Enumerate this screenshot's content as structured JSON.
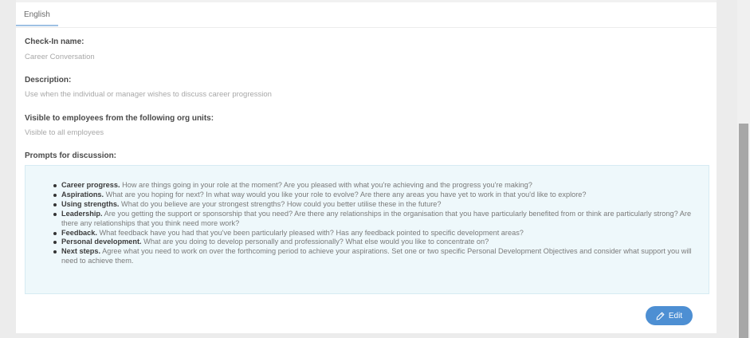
{
  "tabs": [
    {
      "label": "English"
    }
  ],
  "fields": {
    "checkin_name": {
      "label": "Check-In name:",
      "value": "Career Conversation"
    },
    "description": {
      "label": "Description:",
      "value": "Use when the individual or manager wishes to discuss career progression"
    },
    "visibility": {
      "label": "Visible to employees from the following org units:",
      "value": "Visible to all employees"
    },
    "prompts_label": "Prompts for discussion:"
  },
  "prompts": [
    {
      "title": "Career progress.",
      "text": " How are things going in your role at the moment? Are you pleased with what you're achieving and the progress you're making?"
    },
    {
      "title": "Aspirations.",
      "text": " What are you hoping for next? In what way would you like your role to evolve? Are there any areas you have yet to work in that you'd like to explore?"
    },
    {
      "title": "Using strengths.",
      "text": " What do you believe are your strongest strengths? How could you better utilise these in the future?"
    },
    {
      "title": "Leadership.",
      "text": " Are you getting the support or sponsorship that you need? Are there any relationships in the organisation that you have particularly benefited from or think are particularly strong? Are there any relationships that you think need more work?"
    },
    {
      "title": "Feedback.",
      "text": " What feedback have you had that you've been particularly pleased with? Has any feedback pointed to specific development areas?"
    },
    {
      "title": "Personal development.",
      "text": " What are you doing to develop personally and professionally? What else would you like to concentrate on?"
    },
    {
      "title": "Next steps.",
      "text": " Agree what you need to work on over the forthcoming period to achieve your aspirations. Set one or two specific Personal Development Objectives and consider what support you will need to achieve them."
    }
  ],
  "edit_button": {
    "label": "Edit",
    "icon": "pencil-icon"
  },
  "colors": {
    "accent": "#4d8fd3",
    "prompts_background": "#eef8fb"
  }
}
